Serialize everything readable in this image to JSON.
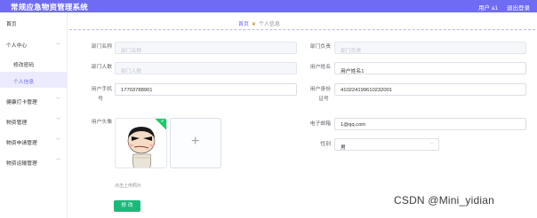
{
  "header": {
    "title": "常规应急物资管理系统",
    "user": "用户 a1",
    "logout": "退出登录",
    "colors": {
      "accent": "#6f6cf3"
    }
  },
  "sidebar": {
    "items": [
      {
        "label": "首页"
      },
      {
        "label": "个人中心",
        "icon": "chevron-up-icon"
      },
      {
        "label": "修改密码"
      },
      {
        "label": "个人信息"
      },
      {
        "label": "健康打卡管理",
        "icon": "chevron-down-icon"
      },
      {
        "label": "物资管理",
        "icon": "chevron-down-icon"
      },
      {
        "label": "物资申请管理",
        "icon": "chevron-down-icon"
      },
      {
        "label": "物资运输管理",
        "icon": "chevron-down-icon"
      }
    ]
  },
  "breadcrumb": {
    "home": "首页",
    "separator_icon": "location-icon",
    "current": "个人信息"
  },
  "form": {
    "dept_name": {
      "label": "部门名称",
      "placeholder": "部门名称"
    },
    "dept_head": {
      "label": "部门负责",
      "placeholder": "部门负责"
    },
    "dept_count": {
      "label": "部门人数",
      "placeholder": "部门人数"
    },
    "user_name": {
      "label": "用户姓名",
      "value": "用户姓名1"
    },
    "phone": {
      "label": "用户手机",
      "label2": "号",
      "value": "17703788901"
    },
    "id_card": {
      "label": "用户身份",
      "label2": "证号",
      "value": "410224199610232001"
    },
    "avatar": {
      "label": "用户头像"
    },
    "email": {
      "label": "电子邮箱",
      "value": "1@qq.com"
    },
    "gender": {
      "label": "性别",
      "value": "男",
      "icon": "chevron-down-icon"
    },
    "upload_hint": "点击上传照片",
    "submit": "修 改"
  },
  "watermark": "CSDN @Mini_yidian"
}
